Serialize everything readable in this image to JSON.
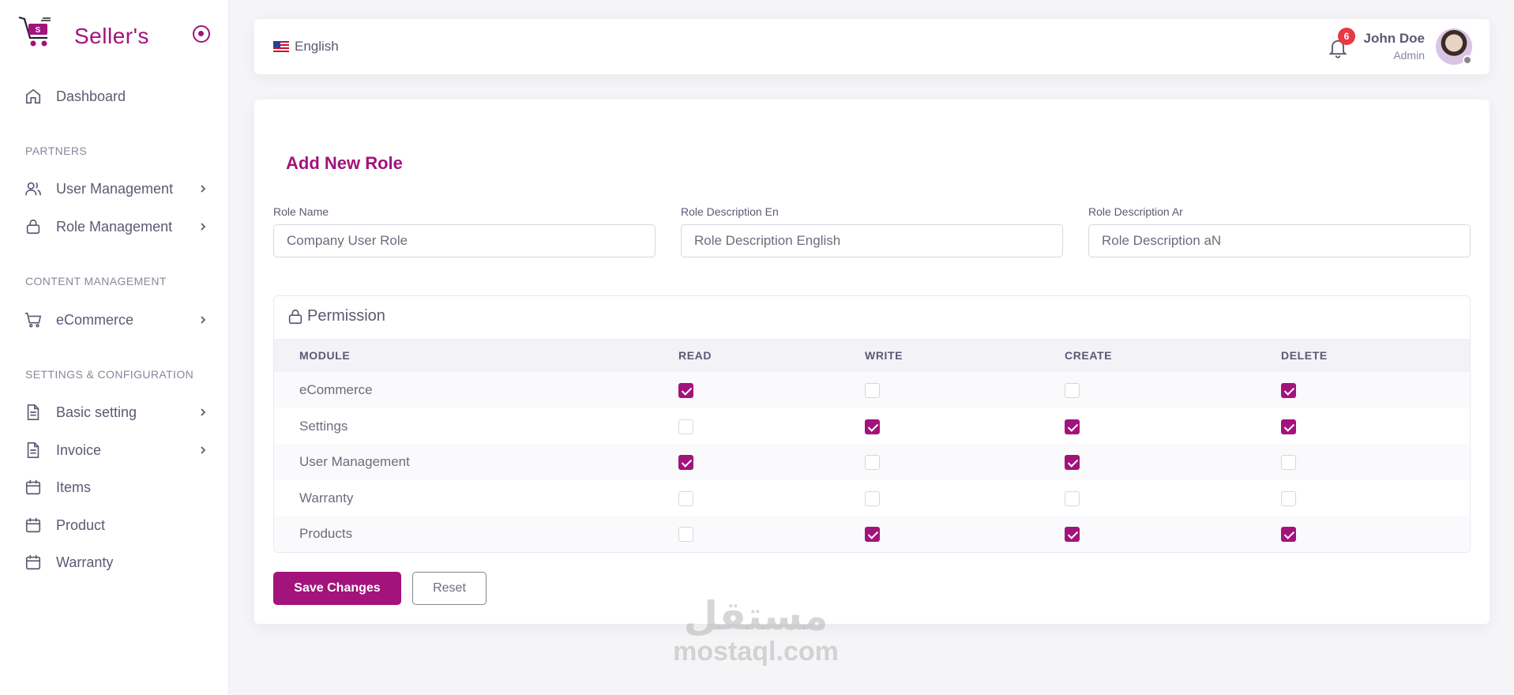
{
  "brand": {
    "name": "Seller's",
    "logo_icon": "shopping-cart-logo",
    "color": "#a2137c"
  },
  "sidebar": {
    "dashboard": {
      "label": "Dashboard",
      "icon": "home-icon"
    },
    "sections": {
      "partners": "PARTNERS",
      "content": "CONTENT MANAGEMENT",
      "settings": "SETTINGS & CONFIGURATION"
    },
    "items": {
      "user_management": {
        "label": "User Management",
        "icon": "users-icon"
      },
      "role_management": {
        "label": "Role Management",
        "icon": "lock-icon"
      },
      "ecommerce": {
        "label": "eCommerce",
        "icon": "cart-icon"
      },
      "basic_setting": {
        "label": "Basic setting",
        "icon": "file-text-icon"
      },
      "invoice": {
        "label": "Invoice",
        "icon": "file-text-icon"
      },
      "items": {
        "label": "Items",
        "icon": "calendar-icon"
      },
      "product": {
        "label": "Product",
        "icon": "calendar-icon"
      },
      "warranty": {
        "label": "Warranty",
        "icon": "calendar-icon"
      }
    }
  },
  "topbar": {
    "language": "English",
    "notifications_count": "6",
    "user_name": "John Doe",
    "user_role": "Admin"
  },
  "form": {
    "title": "Add New Role",
    "role_name_label": "Role Name",
    "role_name_value": "Company User Role",
    "desc_en_label": "Role Description En",
    "desc_en_placeholder": "Role Description English",
    "desc_ar_label": "Role Description Ar",
    "desc_ar_placeholder": "Role Description aN"
  },
  "permissions": {
    "title": "Permission",
    "columns": [
      "MODULE",
      "READ",
      "WRITE",
      "CREATE",
      "DELETE"
    ],
    "rows": [
      {
        "module": "eCommerce",
        "read": true,
        "write": false,
        "create": false,
        "delete": true
      },
      {
        "module": "Settings",
        "read": false,
        "write": true,
        "create": true,
        "delete": true
      },
      {
        "module": "User Management",
        "read": true,
        "write": false,
        "create": true,
        "delete": false
      },
      {
        "module": "Warranty",
        "read": false,
        "write": false,
        "create": false,
        "delete": false
      },
      {
        "module": "Products",
        "read": false,
        "write": true,
        "create": true,
        "delete": true
      }
    ]
  },
  "actions": {
    "save": "Save Changes",
    "reset": "Reset"
  },
  "watermark": {
    "arabic": "مستقل",
    "latin": "mostaql.com"
  },
  "colors": {
    "accent": "#a2137c",
    "badge": "#e63946",
    "text": "#5e5873"
  }
}
